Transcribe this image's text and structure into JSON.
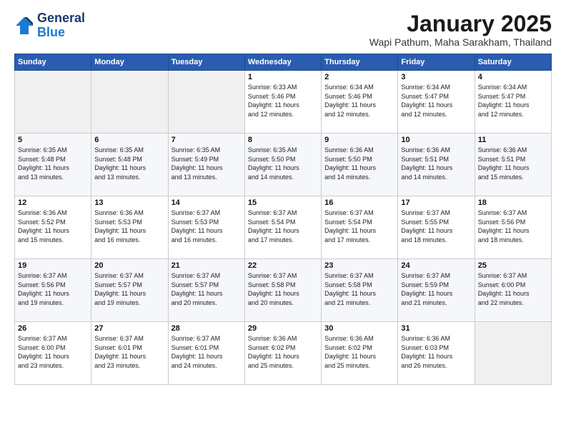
{
  "header": {
    "logo_general": "General",
    "logo_blue": "Blue",
    "month_title": "January 2025",
    "location": "Wapi Pathum, Maha Sarakham, Thailand"
  },
  "days_of_week": [
    "Sunday",
    "Monday",
    "Tuesday",
    "Wednesday",
    "Thursday",
    "Friday",
    "Saturday"
  ],
  "weeks": [
    [
      {
        "day": "",
        "info": ""
      },
      {
        "day": "",
        "info": ""
      },
      {
        "day": "",
        "info": ""
      },
      {
        "day": "1",
        "info": "Sunrise: 6:33 AM\nSunset: 5:46 PM\nDaylight: 11 hours\nand 12 minutes."
      },
      {
        "day": "2",
        "info": "Sunrise: 6:34 AM\nSunset: 5:46 PM\nDaylight: 11 hours\nand 12 minutes."
      },
      {
        "day": "3",
        "info": "Sunrise: 6:34 AM\nSunset: 5:47 PM\nDaylight: 11 hours\nand 12 minutes."
      },
      {
        "day": "4",
        "info": "Sunrise: 6:34 AM\nSunset: 5:47 PM\nDaylight: 11 hours\nand 12 minutes."
      }
    ],
    [
      {
        "day": "5",
        "info": "Sunrise: 6:35 AM\nSunset: 5:48 PM\nDaylight: 11 hours\nand 13 minutes."
      },
      {
        "day": "6",
        "info": "Sunrise: 6:35 AM\nSunset: 5:48 PM\nDaylight: 11 hours\nand 13 minutes."
      },
      {
        "day": "7",
        "info": "Sunrise: 6:35 AM\nSunset: 5:49 PM\nDaylight: 11 hours\nand 13 minutes."
      },
      {
        "day": "8",
        "info": "Sunrise: 6:35 AM\nSunset: 5:50 PM\nDaylight: 11 hours\nand 14 minutes."
      },
      {
        "day": "9",
        "info": "Sunrise: 6:36 AM\nSunset: 5:50 PM\nDaylight: 11 hours\nand 14 minutes."
      },
      {
        "day": "10",
        "info": "Sunrise: 6:36 AM\nSunset: 5:51 PM\nDaylight: 11 hours\nand 14 minutes."
      },
      {
        "day": "11",
        "info": "Sunrise: 6:36 AM\nSunset: 5:51 PM\nDaylight: 11 hours\nand 15 minutes."
      }
    ],
    [
      {
        "day": "12",
        "info": "Sunrise: 6:36 AM\nSunset: 5:52 PM\nDaylight: 11 hours\nand 15 minutes."
      },
      {
        "day": "13",
        "info": "Sunrise: 6:36 AM\nSunset: 5:53 PM\nDaylight: 11 hours\nand 16 minutes."
      },
      {
        "day": "14",
        "info": "Sunrise: 6:37 AM\nSunset: 5:53 PM\nDaylight: 11 hours\nand 16 minutes."
      },
      {
        "day": "15",
        "info": "Sunrise: 6:37 AM\nSunset: 5:54 PM\nDaylight: 11 hours\nand 17 minutes."
      },
      {
        "day": "16",
        "info": "Sunrise: 6:37 AM\nSunset: 5:54 PM\nDaylight: 11 hours\nand 17 minutes."
      },
      {
        "day": "17",
        "info": "Sunrise: 6:37 AM\nSunset: 5:55 PM\nDaylight: 11 hours\nand 18 minutes."
      },
      {
        "day": "18",
        "info": "Sunrise: 6:37 AM\nSunset: 5:56 PM\nDaylight: 11 hours\nand 18 minutes."
      }
    ],
    [
      {
        "day": "19",
        "info": "Sunrise: 6:37 AM\nSunset: 5:56 PM\nDaylight: 11 hours\nand 19 minutes."
      },
      {
        "day": "20",
        "info": "Sunrise: 6:37 AM\nSunset: 5:57 PM\nDaylight: 11 hours\nand 19 minutes."
      },
      {
        "day": "21",
        "info": "Sunrise: 6:37 AM\nSunset: 5:57 PM\nDaylight: 11 hours\nand 20 minutes."
      },
      {
        "day": "22",
        "info": "Sunrise: 6:37 AM\nSunset: 5:58 PM\nDaylight: 11 hours\nand 20 minutes."
      },
      {
        "day": "23",
        "info": "Sunrise: 6:37 AM\nSunset: 5:58 PM\nDaylight: 11 hours\nand 21 minutes."
      },
      {
        "day": "24",
        "info": "Sunrise: 6:37 AM\nSunset: 5:59 PM\nDaylight: 11 hours\nand 21 minutes."
      },
      {
        "day": "25",
        "info": "Sunrise: 6:37 AM\nSunset: 6:00 PM\nDaylight: 11 hours\nand 22 minutes."
      }
    ],
    [
      {
        "day": "26",
        "info": "Sunrise: 6:37 AM\nSunset: 6:00 PM\nDaylight: 11 hours\nand 23 minutes."
      },
      {
        "day": "27",
        "info": "Sunrise: 6:37 AM\nSunset: 6:01 PM\nDaylight: 11 hours\nand 23 minutes."
      },
      {
        "day": "28",
        "info": "Sunrise: 6:37 AM\nSunset: 6:01 PM\nDaylight: 11 hours\nand 24 minutes."
      },
      {
        "day": "29",
        "info": "Sunrise: 6:36 AM\nSunset: 6:02 PM\nDaylight: 11 hours\nand 25 minutes."
      },
      {
        "day": "30",
        "info": "Sunrise: 6:36 AM\nSunset: 6:02 PM\nDaylight: 11 hours\nand 25 minutes."
      },
      {
        "day": "31",
        "info": "Sunrise: 6:36 AM\nSunset: 6:03 PM\nDaylight: 11 hours\nand 26 minutes."
      },
      {
        "day": "",
        "info": ""
      }
    ]
  ]
}
